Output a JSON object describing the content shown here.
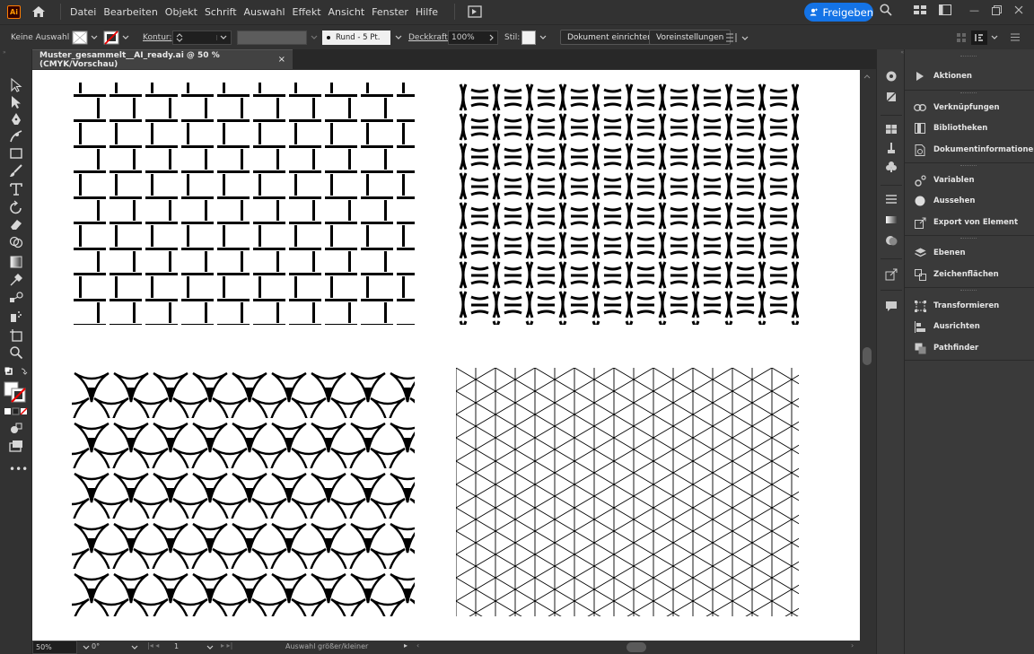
{
  "app": {
    "logo_text": "Ai"
  },
  "menu": [
    "Datei",
    "Bearbeiten",
    "Objekt",
    "Schrift",
    "Auswahl",
    "Effekt",
    "Ansicht",
    "Fenster",
    "Hilfe"
  ],
  "share": {
    "label": "Freigeben"
  },
  "control": {
    "selection": "Keine Auswahl",
    "stroke_label": "Kontur:",
    "brush": "Rund - 5 Pt.",
    "opacity_label": "Deckkraft:",
    "opacity_value": "100%",
    "style_label": "Stil:",
    "doc_setup": "Dokument einrichten",
    "preferences": "Voreinstellungen"
  },
  "document": {
    "tab_title": "Muster_gesammelt__AI_ready.ai @ 50 % (CMYK/Vorschau)",
    "close": "×"
  },
  "status": {
    "zoom": "50%",
    "rotation": "0°",
    "artboard": "1",
    "message": "Auswahl größer/kleiner"
  },
  "panels": [
    {
      "label": "Aktionen",
      "icon": "play-icon"
    },
    {
      "label": "Verknüpfungen",
      "icon": "link-icon"
    },
    {
      "label": "Bibliotheken",
      "icon": "library-icon"
    },
    {
      "label": "Dokumentinformationen",
      "icon": "info-icon"
    },
    {
      "label": "Variablen",
      "icon": "variables-icon"
    },
    {
      "label": "Aussehen",
      "icon": "appearance-icon"
    },
    {
      "label": "Export von Element",
      "icon": "export-icon"
    },
    {
      "label": "Ebenen",
      "icon": "layers-icon"
    },
    {
      "label": "Zeichenflächen",
      "icon": "artboards-icon"
    },
    {
      "label": "Transformieren",
      "icon": "transform-icon"
    },
    {
      "label": "Ausrichten",
      "icon": "align-icon"
    },
    {
      "label": "Pathfinder",
      "icon": "pathfinder-icon"
    }
  ],
  "colors": {
    "accent": "#1473e6",
    "ui_bg": "#323232",
    "panel_bg": "#3a3a3a",
    "canvas": "#ffffff"
  }
}
